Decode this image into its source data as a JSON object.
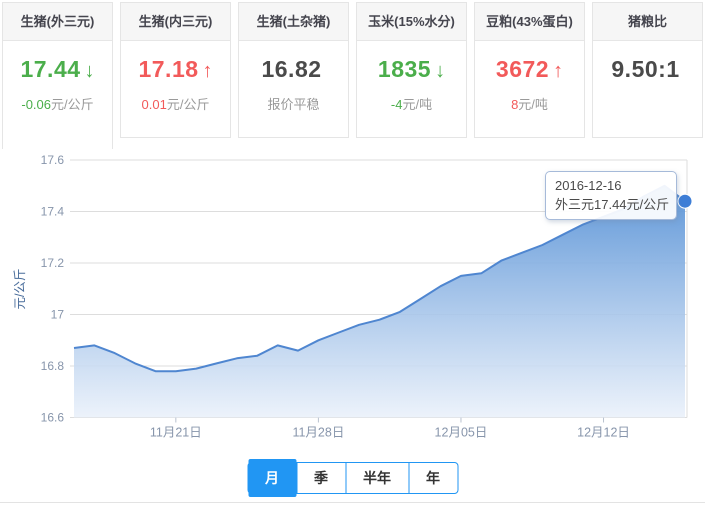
{
  "cards": [
    {
      "title": "生猪(外三元)",
      "value": "17.44",
      "arrow": "↓",
      "trend": "down",
      "sub_value": "-0.06",
      "sub_unit": "元/公斤"
    },
    {
      "title": "生猪(内三元)",
      "value": "17.18",
      "arrow": "↑",
      "trend": "up",
      "sub_value": "0.01",
      "sub_unit": "元/公斤"
    },
    {
      "title": "生猪(土杂猪)",
      "value": "16.82",
      "arrow": "",
      "trend": "flat",
      "sub_value": "",
      "sub_unit": "报价平稳"
    },
    {
      "title": "玉米(15%水分)",
      "value": "1835",
      "arrow": "↓",
      "trend": "down",
      "sub_value": "-4",
      "sub_unit": "元/吨"
    },
    {
      "title": "豆粕(43%蛋白)",
      "value": "3672",
      "arrow": "↑",
      "trend": "up",
      "sub_value": "8",
      "sub_unit": "元/吨"
    },
    {
      "title": "猪粮比",
      "value": "9.50:1",
      "arrow": "",
      "trend": "flat",
      "sub_value": "",
      "sub_unit": ""
    }
  ],
  "tabs": [
    {
      "label": "月",
      "active": true
    },
    {
      "label": "季",
      "active": false
    },
    {
      "label": "半年",
      "active": false
    },
    {
      "label": "年",
      "active": false
    }
  ],
  "colors": {
    "up": "#f25a5a",
    "down": "#4bae4b",
    "flat": "#4a4a4a",
    "tab_blue": "#2196f3",
    "grid": "#dddddd",
    "tick_label": "#8795ab",
    "axis_name": "#4a6d9b",
    "line": "#4f86d0",
    "area_top": "#5691d6",
    "area_bottom": "#e9f0fa",
    "marker": "#3e7ed6"
  },
  "chart_data": {
    "type": "area",
    "title": "",
    "series_name": "外三元",
    "ylabel": "元/公斤",
    "ylim": [
      16.6,
      17.6
    ],
    "yticks": [
      "16.6",
      "16.8",
      "17",
      "17.2",
      "17.4",
      "17.6"
    ],
    "grid": true,
    "legend_position": "none",
    "x": [
      "2016-11-16",
      "2016-11-17",
      "2016-11-18",
      "2016-11-19",
      "2016-11-20",
      "2016-11-21",
      "2016-11-22",
      "2016-11-23",
      "2016-11-24",
      "2016-11-25",
      "2016-11-26",
      "2016-11-27",
      "2016-11-28",
      "2016-11-29",
      "2016-11-30",
      "2016-12-01",
      "2016-12-02",
      "2016-12-03",
      "2016-12-04",
      "2016-12-05",
      "2016-12-06",
      "2016-12-07",
      "2016-12-08",
      "2016-12-09",
      "2016-12-10",
      "2016-12-11",
      "2016-12-12",
      "2016-12-13",
      "2016-12-14",
      "2016-12-15",
      "2016-12-16"
    ],
    "values": [
      16.87,
      16.88,
      16.85,
      16.81,
      16.78,
      16.78,
      16.79,
      16.81,
      16.83,
      16.84,
      16.88,
      16.86,
      16.9,
      16.93,
      16.96,
      16.98,
      17.01,
      17.06,
      17.11,
      17.15,
      17.16,
      17.21,
      17.24,
      17.27,
      17.31,
      17.35,
      17.38,
      17.41,
      17.46,
      17.5,
      17.44
    ],
    "xtick_indices": [
      5,
      12,
      19,
      26
    ],
    "xtick_labels": [
      "11月21日",
      "11月28日",
      "12月05日",
      "12月12日"
    ],
    "tooltip": {
      "line1": "2016-12-16",
      "line2": "外三元17.44元/公斤",
      "point_index": 30
    }
  }
}
